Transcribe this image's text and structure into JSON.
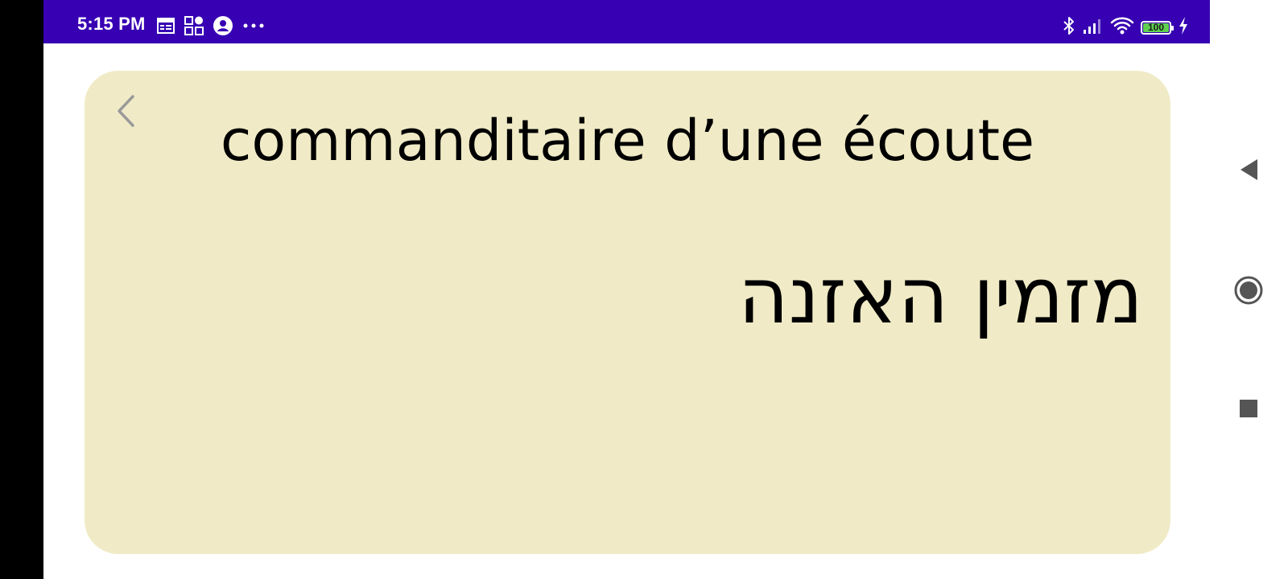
{
  "status_bar": {
    "time": "5:15 PM",
    "left_icons": [
      "calendar-icon",
      "apps-grid-icon",
      "account-circle-icon",
      "more-dots-icon"
    ],
    "right_icons": [
      "bluetooth-icon",
      "signal-icon",
      "wifi-icon",
      "battery-icon",
      "charging-icon"
    ],
    "battery_level": "100",
    "background_color": "#3700b3"
  },
  "card": {
    "term": "commanditaire d’une écoute",
    "translation": "מזמין האזנה",
    "background_color": "#f0ebc6",
    "back_icon": "chevron-left-icon"
  },
  "nav_bar": {
    "buttons": [
      "back-triangle-icon",
      "home-circle-icon",
      "recents-square-icon"
    ]
  }
}
